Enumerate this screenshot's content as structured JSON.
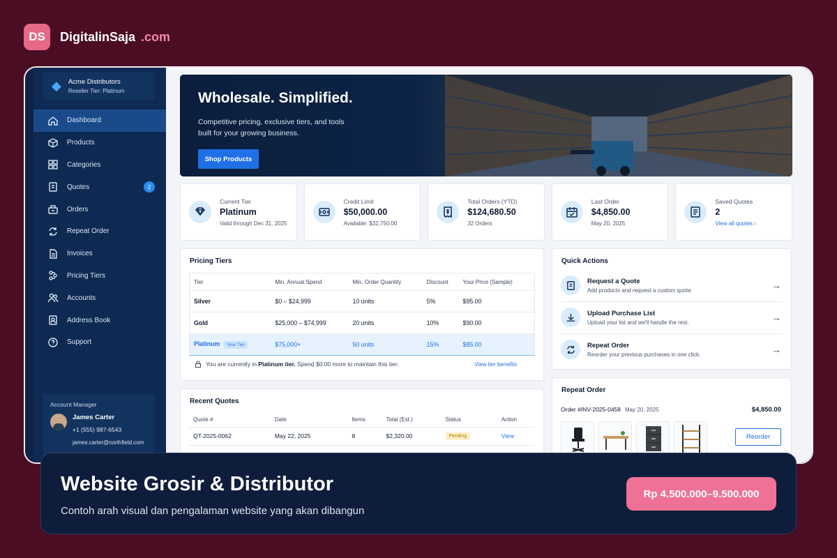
{
  "brand": {
    "badge": "DS",
    "name": "DigitalinSaja",
    "tld": ".com"
  },
  "account": {
    "name": "Acme Distributors",
    "tier": "Reseller Tier: Platinum"
  },
  "nav": [
    {
      "label": "Dashboard",
      "icon": "home-icon",
      "active": true
    },
    {
      "label": "Products",
      "icon": "box-icon"
    },
    {
      "label": "Categories",
      "icon": "grid-icon"
    },
    {
      "label": "Quotes",
      "icon": "quote-icon",
      "badge": "2"
    },
    {
      "label": "Orders",
      "icon": "orders-icon"
    },
    {
      "label": "Repeat Order",
      "icon": "repeat-icon"
    },
    {
      "label": "Invoices",
      "icon": "invoice-icon"
    },
    {
      "label": "Pricing Tiers",
      "icon": "tiers-icon"
    },
    {
      "label": "Accounts",
      "icon": "users-icon"
    },
    {
      "label": "Address Book",
      "icon": "address-book-icon"
    },
    {
      "label": "Support",
      "icon": "help-icon"
    }
  ],
  "manager": {
    "title": "Account Manager",
    "name": "James Carter",
    "phone": "+1 (555) 987-6543",
    "email": "james.carter@northfield.com"
  },
  "hero": {
    "title": "Wholesale. Simplified.",
    "subtitle": "Competitive pricing, exclusive tiers, and tools built for your growing business.",
    "button": "Shop Products"
  },
  "stats": [
    {
      "label": "Current Tier",
      "value": "Platinum",
      "sub": "Valid through Dec 31, 2025",
      "icon": "diamond-icon"
    },
    {
      "label": "Credit Limit",
      "value": "$50,000.00",
      "sub": "Available: $32,750.00",
      "icon": "wallet-icon"
    },
    {
      "label": "Total Orders (YTD)",
      "value": "$124,680.50",
      "sub": "32 Orders",
      "icon": "receipt-icon"
    },
    {
      "label": "Last Order",
      "value": "$4,850.00",
      "sub": "May 20, 2025",
      "icon": "calendar-icon"
    },
    {
      "label": "Saved Quotes",
      "value": "2",
      "sub": "View all quotes  ›",
      "icon": "document-icon",
      "link": true
    }
  ],
  "pricing": {
    "title": "Pricing Tiers",
    "headers": [
      "Tier",
      "Min. Annual Spend",
      "Min. Order Quantity",
      "Discount",
      "Your Price (Sample)"
    ],
    "rows": [
      {
        "tier": "Silver",
        "spend": "$0 – $24,999",
        "qty": "10 units",
        "discount": "5%",
        "price": "$95.00"
      },
      {
        "tier": "Gold",
        "spend": "$25,000 – $74,999",
        "qty": "20 units",
        "discount": "10%",
        "price": "$90.00"
      },
      {
        "tier": "Platinum",
        "badge": "Your Tier",
        "spend": "$75,000+",
        "qty": "50 units",
        "discount": "15%",
        "price": "$85.00",
        "current": true
      }
    ],
    "note_pre": "You are currently in ",
    "note_bold": "Platinum tier.",
    "note_post": " Spend $0.00 more to maintain this tier.",
    "link": "View tier benefits"
  },
  "quotes": {
    "title": "Recent Quotes",
    "headers": [
      "Quote #",
      "Date",
      "Items",
      "Total (Est.)",
      "Status",
      "Action"
    ],
    "rows": [
      {
        "id": "QT-2025-0062",
        "date": "May 22, 2025",
        "items": "8",
        "total": "$2,320.00",
        "status": "Pending",
        "action": "View"
      }
    ]
  },
  "quick_actions": {
    "title": "Quick Actions",
    "items": [
      {
        "title": "Request a Quote",
        "desc": "Add products and request a custom quote.",
        "icon": "quote-request-icon"
      },
      {
        "title": "Upload Purchase List",
        "desc": "Upload your list and we'll handle the rest.",
        "icon": "upload-icon"
      },
      {
        "title": "Repeat Order",
        "desc": "Reorder your previous purchases in one click.",
        "icon": "repeat-icon"
      }
    ]
  },
  "repeat_order": {
    "title": "Repeat Order",
    "order": "Order #INV-2025-0458",
    "date": "May 20, 2025",
    "total": "$4,850.00",
    "button": "Reorder"
  },
  "banner": {
    "title": "Website Grosir & Distributor",
    "subtitle": "Contoh arah visual dan pengalaman website yang akan dibangun",
    "price": "Rp 4.500.000–9.500.000"
  },
  "colors": {
    "accent": "#1f6fe6",
    "brand_pink": "#ef7195",
    "sidebar": "#0e2a52",
    "background": "#4a0d24"
  }
}
